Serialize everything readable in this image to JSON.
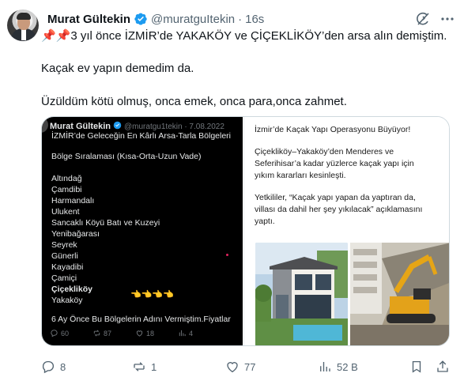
{
  "author": {
    "name": "Murat Gültekin",
    "handle": "@muratguItekin",
    "separator": "·",
    "time": "16s"
  },
  "tweet": {
    "line1": "3 yıl önce İZMİR’de YAKAKÖY ve ÇİÇEKLİKÖY’den arsa alın demiştim.",
    "line1_emoji": "📌📌",
    "line2": "Kaçak ev yapın demedim da.",
    "line3": "Üzüldüm kötü olmuş, onca emek, onca para,onca zahmet."
  },
  "embedded_screenshot": {
    "name": "Murat Gültekin",
    "handle": "@muratgu1tekin · 7.08.2022",
    "title": "İZMİR’de Geleceğin En Kârlı Arsa-Tarla Bölgeleri",
    "subtitle": "Bölge Sıralaması (Kısa-Orta-Uzun Vade)",
    "regions": [
      "Altındağ",
      "Çamdibi",
      "Harmandalı",
      "Ulukent",
      "Sancaklı Köyü Batı ve Kuzeyi",
      "Yenibağarası",
      "Seyrek",
      "Günerli",
      "Kayadibi",
      "Çamiçi"
    ],
    "highlight": "Çiçekliköy",
    "last_region": "Yakaköy",
    "hands": "👈👈👈👈",
    "footer": "6 Ay Önce Bu Bölgelerin Adını Vermiştim.Fiyatlar",
    "replies": "60",
    "reposts": "87",
    "likes": "18",
    "views": "4"
  },
  "news": {
    "headline": "İzmir’de Kaçak Yapı Operasyonu Büyüyor!",
    "para1_l1": "Çiçekliköy–Yakaköy’den Menderes ve",
    "para1_l2": "Seferihisar’a kadar yüzlerce kaçak yapı için",
    "para1_l3": "yıkım kararları kesinleşti.",
    "para2_l1": "Yetkililer, “Kaçak yapı yapan da yaptıran da,",
    "para2_l2": "villası da dahil her şey yıkılacak” açıklamasını",
    "para2_l3": "yaptı."
  },
  "actions": {
    "replies": "8",
    "reposts": "1",
    "likes": "77",
    "views": "52 B"
  },
  "icons": {
    "verified": "verified-badge-icon",
    "grok": "grok-icon",
    "more": "more-icon",
    "reply": "reply-icon",
    "repost": "repost-icon",
    "like": "heart-icon",
    "views": "views-icon",
    "bookmark": "bookmark-icon",
    "share": "share-icon"
  },
  "colors": {
    "verified": "#1d9bf0",
    "text": "#0f1419",
    "muted": "#536471",
    "border": "#cfd9de"
  }
}
